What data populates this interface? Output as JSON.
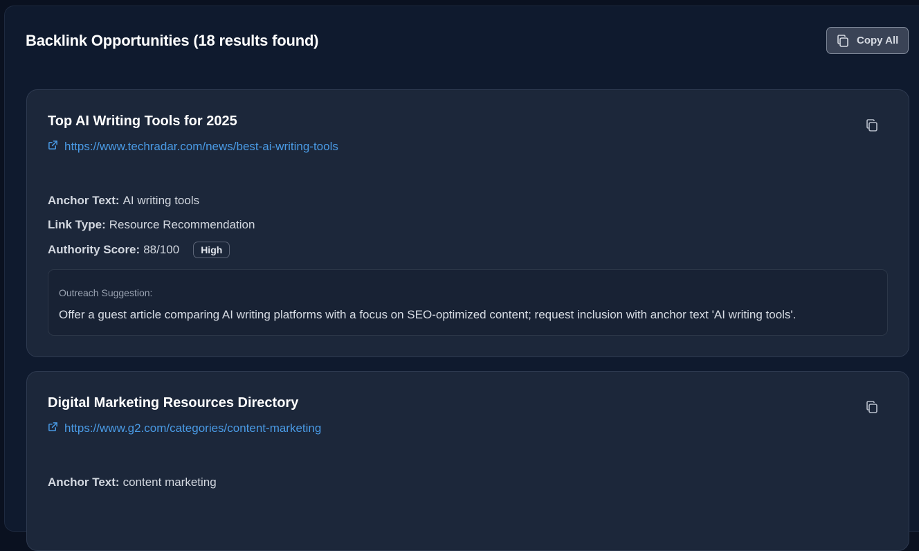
{
  "panel": {
    "title": "Backlink Opportunities (18 results found)",
    "copy_all_label": "Copy All",
    "copy_all_icon": "copy-icon"
  },
  "cards": [
    {
      "title": "Top AI Writing Tools for 2025",
      "url": "https://www.techradar.com/news/best-ai-writing-tools",
      "anchor_label": "Anchor Text:",
      "anchor_value": "AI writing tools",
      "link_type_label": "Link Type:",
      "link_type_value": "Resource Recommendation",
      "authority_label": "Authority Score:",
      "authority_value": "88/100",
      "authority_badge": "High",
      "outreach_label": "Outreach Suggestion:",
      "outreach_text": "Offer a guest article comparing AI writing platforms with a focus on SEO-optimized content; request inclusion with anchor text 'AI writing tools'."
    },
    {
      "title": "Digital Marketing Resources Directory",
      "url": "https://www.g2.com/categories/content-marketing",
      "anchor_label": "Anchor Text:",
      "anchor_value": "content marketing"
    }
  ],
  "colors": {
    "background": "#0a1120",
    "panel": "#0f1a2e",
    "card": "#1c273a",
    "link": "#4a9be6",
    "text": "#d3d8e0"
  }
}
